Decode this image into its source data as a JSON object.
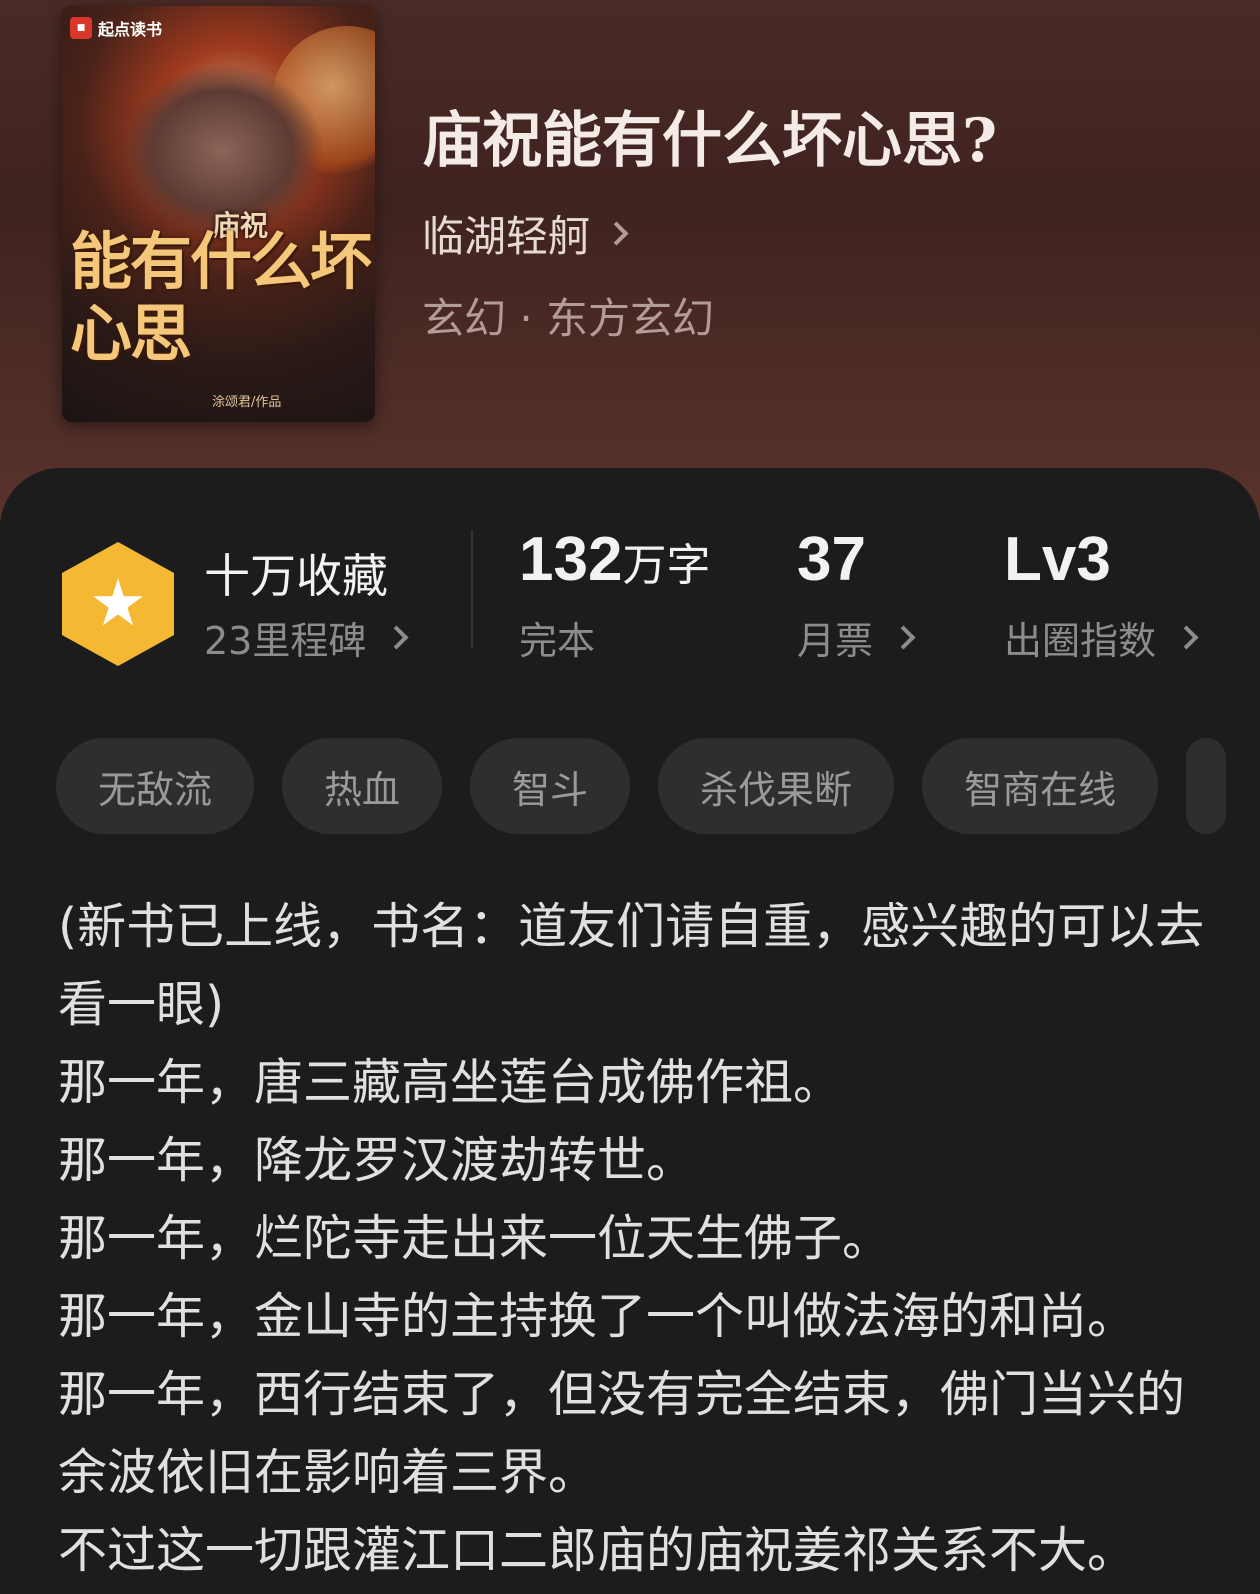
{
  "book": {
    "title": "庙祝能有什么坏心思?",
    "author": "临湖轻舸",
    "genre": "玄幻 · 东方玄幻",
    "cover": {
      "platform": "起点读书",
      "small_title": "庙祝",
      "big_title": "能有什么坏心思",
      "author_mark": "涂颂君/作品"
    }
  },
  "stats": {
    "collection": {
      "title": "十万收藏",
      "milestone": "23里程碑",
      "icon": "star-hexagon-icon",
      "color": "#f5b833"
    },
    "words": {
      "number": "132",
      "unit": "万字",
      "label": "完本"
    },
    "monthly_votes": {
      "number": "37",
      "label": "月票"
    },
    "popularity": {
      "number": "Lv3",
      "label": "出圈指数"
    }
  },
  "tags": [
    "无敌流",
    "热血",
    "智斗",
    "杀伐果断",
    "智商在线"
  ],
  "description": [
    "(新书已上线，书名：道友们请自重，感兴趣的可以去看一眼)",
    "那一年，唐三藏高坐莲台成佛作祖。",
    "那一年，降龙罗汉渡劫转世。",
    "那一年，烂陀寺走出来一位天生佛子。",
    "那一年，金山寺的主持换了一个叫做法海的和尚。",
    "那一年，西行结束了，但没有完全结束，佛门当兴的余波依旧在影响着三界。",
    "不过这一切跟灌江口二郎庙的庙祝姜祁关系不大。"
  ]
}
